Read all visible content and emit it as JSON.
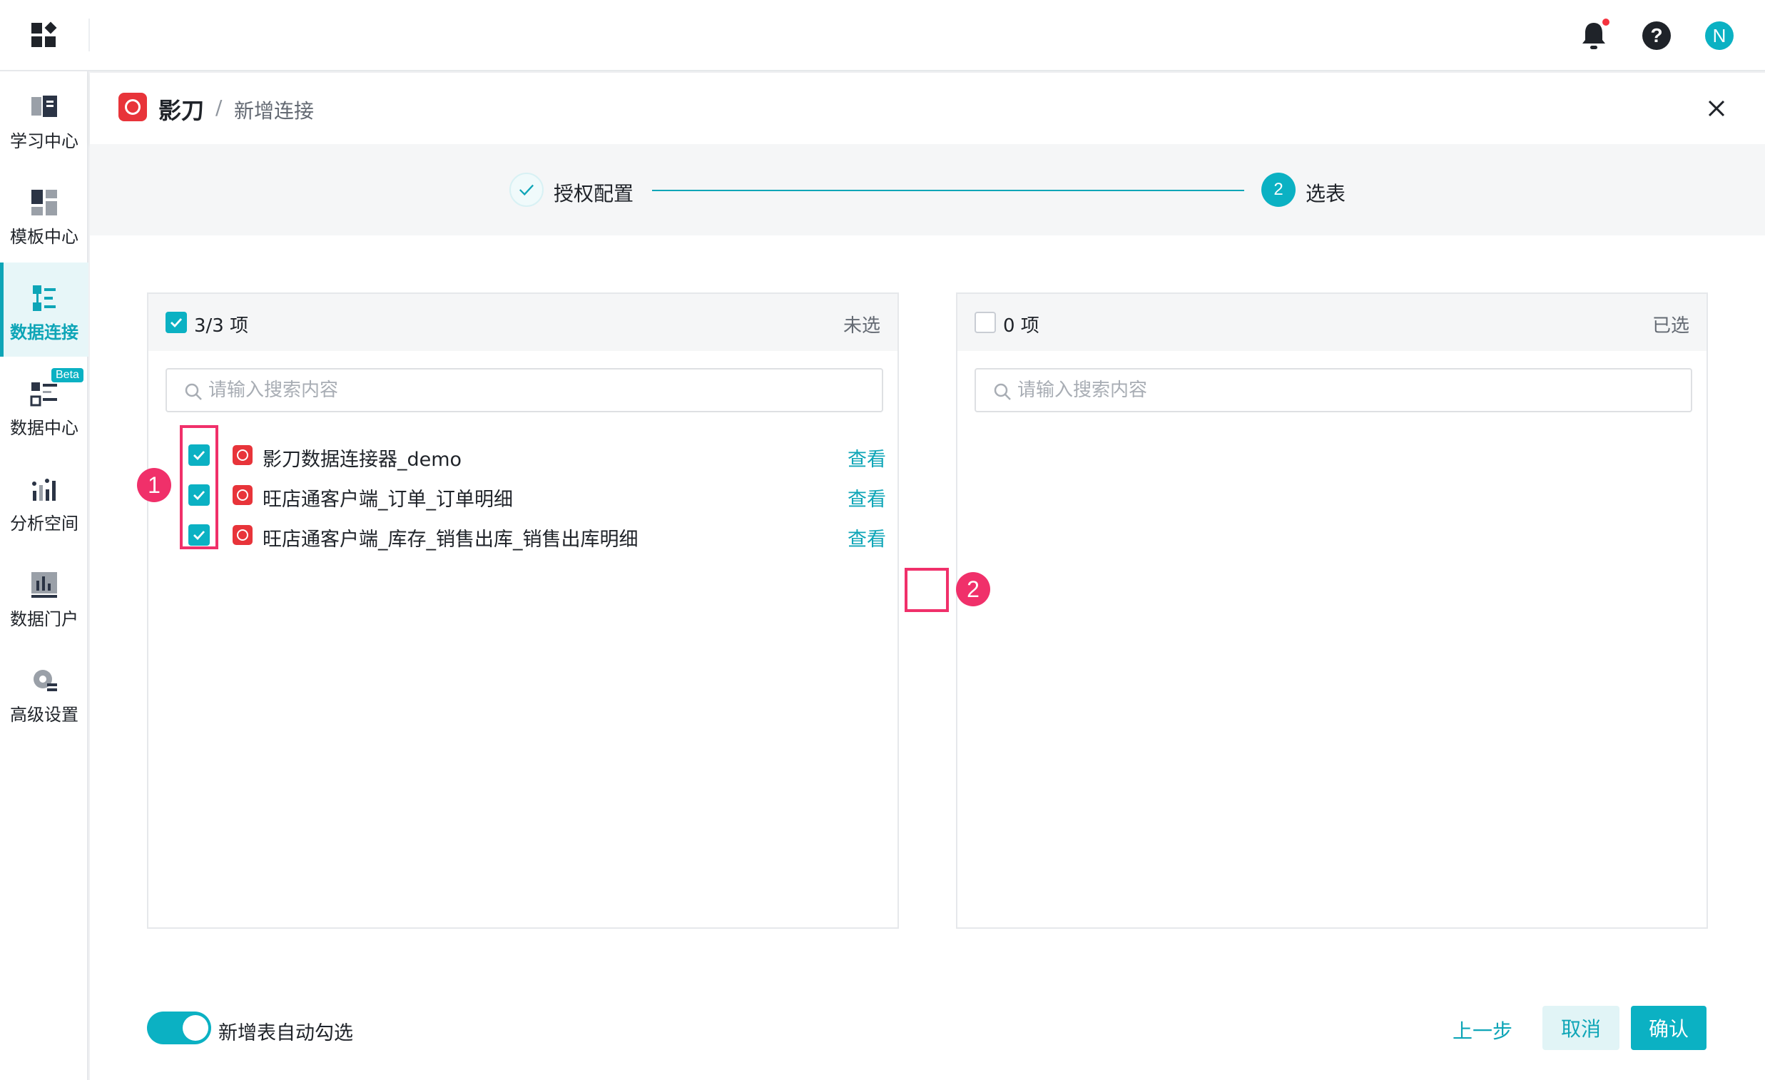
{
  "sidebar": {
    "items": [
      {
        "label": "学习中心",
        "icon": "book-icon"
      },
      {
        "label": "模板中心",
        "icon": "template-icon"
      },
      {
        "label": "数据连接",
        "icon": "data-connection-icon",
        "active": true
      },
      {
        "label": "数据中心",
        "icon": "data-center-icon",
        "badge": "Beta"
      },
      {
        "label": "分析空间",
        "icon": "analysis-icon"
      },
      {
        "label": "数据门户",
        "icon": "portal-icon"
      },
      {
        "label": "高级设置",
        "icon": "settings-gear-icon"
      }
    ]
  },
  "topbar": {
    "avatar_initial": "N",
    "help_glyph": "?"
  },
  "header": {
    "title": "影刀",
    "separator": "/",
    "subtitle": "新增连接"
  },
  "steps": [
    {
      "label": "授权配置",
      "state": "done"
    },
    {
      "number": "2",
      "label": "选表",
      "state": "active"
    }
  ],
  "transfer": {
    "left": {
      "count": "3/3 项",
      "state_label": "未选",
      "search_placeholder": "请输入搜索内容",
      "items": [
        {
          "label": "影刀数据连接器_demo",
          "action": "查看",
          "checked": true
        },
        {
          "label": "旺店通客户端_订单_订单明细",
          "action": "查看",
          "checked": true
        },
        {
          "label": "旺店通客户端_库存_销售出库_销售出库明细",
          "action": "查看",
          "checked": true
        }
      ]
    },
    "right": {
      "count": "0 项",
      "state_label": "已选",
      "search_placeholder": "请输入搜索内容",
      "items": []
    }
  },
  "annotations": {
    "one": "1",
    "two": "2"
  },
  "footer": {
    "toggle_label": "新增表自动勾选",
    "toggle_on": true,
    "prev_label": "上一步",
    "cancel_label": "取消",
    "confirm_label": "确认"
  },
  "colors": {
    "accent": "#0bb1c3",
    "annotation": "#f0306a",
    "brand_red": "#e8343a"
  }
}
